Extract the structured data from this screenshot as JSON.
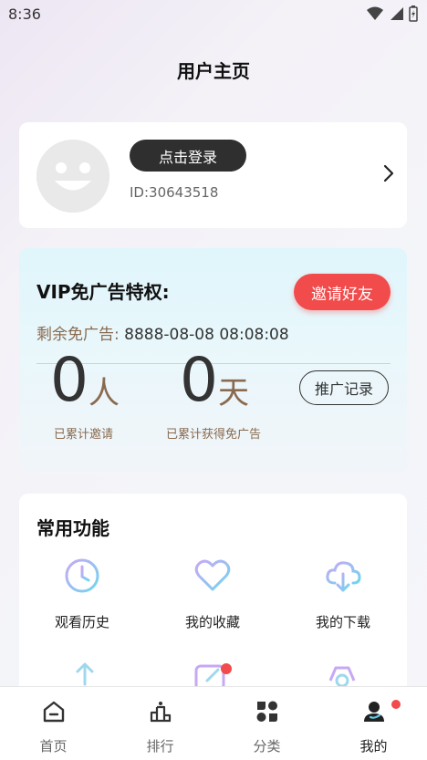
{
  "status": {
    "time": "8:36"
  },
  "page": {
    "title": "用户主页"
  },
  "profile": {
    "login_label": "点击登录",
    "user_id": "ID:30643518"
  },
  "vip": {
    "title": "VIP免广告特权:",
    "invite_label": "邀请好友",
    "remaining_label": "剩余免广告:",
    "remaining_value": "8888-08-08 08:08:08",
    "invited_count": "0",
    "invited_unit": "人",
    "invited_caption": "已累计邀请",
    "days_count": "0",
    "days_unit": "天",
    "days_caption": "已累计获得免广告",
    "record_label": "推广记录"
  },
  "features": {
    "title": "常用功能",
    "items": [
      {
        "label": "观看历史",
        "icon": "history-clock-icon"
      },
      {
        "label": "我的收藏",
        "icon": "heart-icon"
      },
      {
        "label": "我的下载",
        "icon": "cloud-download-icon"
      }
    ]
  },
  "tabs": [
    {
      "label": "首页",
      "icon": "home-icon"
    },
    {
      "label": "排行",
      "icon": "ranking-icon"
    },
    {
      "label": "分类",
      "icon": "category-icon"
    },
    {
      "label": "我的",
      "icon": "profile-icon",
      "active": true
    }
  ],
  "colors": {
    "accent": "#f14b4b",
    "dark_button": "#2f2f2f",
    "gold_text": "#8a6a4e"
  }
}
